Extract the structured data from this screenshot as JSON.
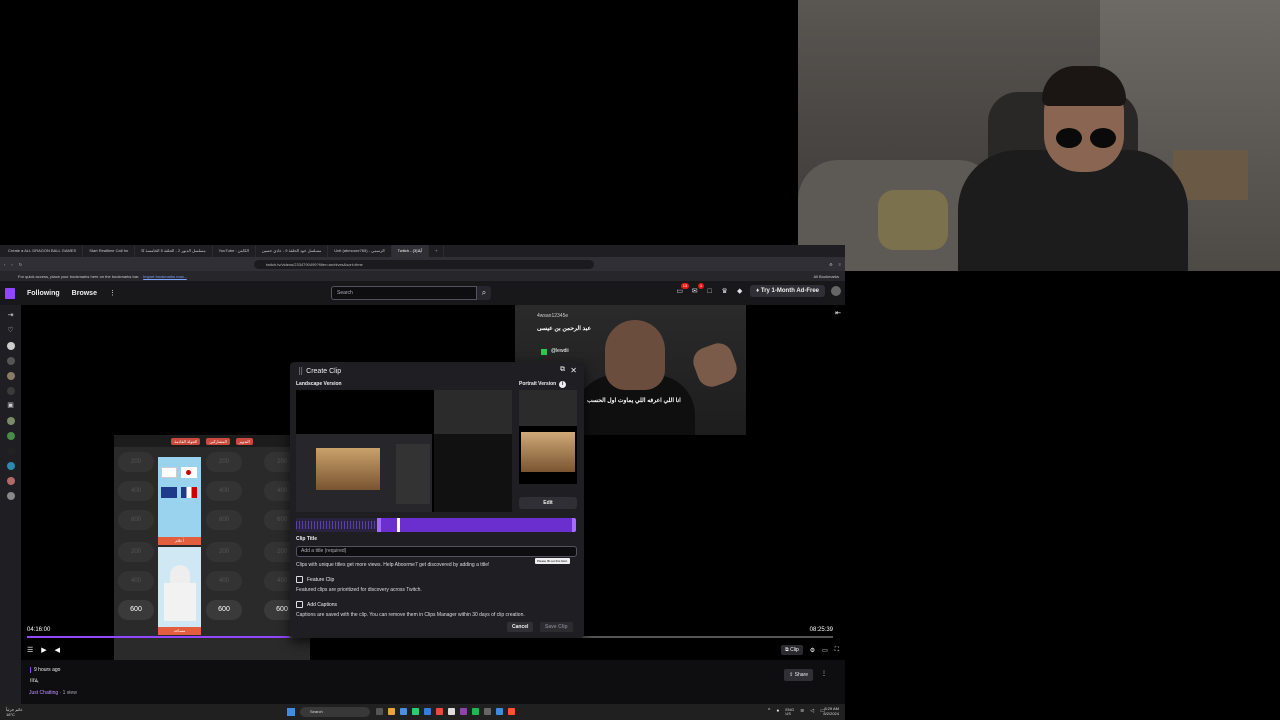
{
  "browser": {
    "tabs": [
      {
        "label": "Create a ALL DRAGON BALL GAMES",
        "active": false
      },
      {
        "label": "Start Realtime Call for",
        "active": false
      },
      {
        "label": "مسلسل الدبور 2 - الحلقة 5 الخامسة كا",
        "active": false
      },
      {
        "label": "YouTube : الكابتن",
        "active": false
      },
      {
        "label": "مسلسل خود الحلقة 9 - عادي حسين",
        "active": false
      },
      {
        "label": "Unit (abmoore765) - الرسمي",
        "active": false
      },
      {
        "label": "Twitch - آيلا(3)",
        "active": true
      }
    ],
    "url": "twitch.tv/videos/2334790499?filter=archives&sort=time",
    "bookmark_hint": "For quick access, place your bookmarks here on the bookmarks bar.",
    "bookmark_link": "Import bookmarks now...",
    "all_bookmarks": "All Bookmarks"
  },
  "nav": {
    "following": "Following",
    "browse": "Browse",
    "more": "⋮",
    "search_placeholder": "Search",
    "notif_count": "13",
    "inbox_count": "1",
    "ad_free": "Try 1-Month Ad-Free"
  },
  "player": {
    "time_current": "04:16:00",
    "time_total": "08:25:39",
    "clip_label": "Clip",
    "progress_fraction": 0.325,
    "gameboard": {
      "header": [
        "الجولة القادمة",
        "المشاركين",
        "التدوير"
      ],
      "columns": [
        {
          "values": [
            "200",
            "400",
            "600",
            "200",
            "400",
            "600"
          ]
        },
        {
          "values": [
            "200",
            "400",
            "600",
            "200",
            "400",
            "600"
          ]
        },
        {
          "values": [
            "200",
            "400",
            "600",
            "200",
            "400",
            "600"
          ]
        }
      ],
      "card_labels": [
        "أعلام",
        "مساجد"
      ]
    },
    "cam_overlay": {
      "user1": "4wsan12345e",
      "name": "عبد الرحمن بن عيسى",
      "sub": "@lewdii",
      "caption": "انا اللي اعرفه اللي يماوت اول الحسب"
    }
  },
  "clip_modal": {
    "title": "Create Clip",
    "landscape_label": "Landscape Version",
    "portrait_label": "Portrait Version",
    "info_icon": "i",
    "edit_label": "Edit",
    "clip_title_label": "Clip Title",
    "title_placeholder": "Add a title (required)",
    "tooltip": "Please fill out this field.",
    "help_text": "Clips with unique titles get more views. Help Aboorme7 get discovered by adding a title!",
    "feature_label": "Feature Clip",
    "feature_sub": "Featured clips are prioritized for discovery across Twitch.",
    "captions_label": "Add Captions",
    "captions_sub": "Captions are saved with the clip. You can remove them in Clips Manager within 30 days of clip creation.",
    "cancel_label": "Cancel",
    "save_label": "Save Clip"
  },
  "video_info": {
    "date": "9 hours ago",
    "title": "يلاااا",
    "category": "Just Chatting",
    "views": " · 1 view",
    "share": "Share"
  },
  "taskbar": {
    "weather": "غائم جزئياً",
    "temp": "18°C",
    "search": "Search",
    "lang": "ENG",
    "region": "US",
    "time": "8:29 AM",
    "date": "8/2/2024"
  },
  "colors": {
    "accent": "#9147ff",
    "bg": "#0e0e10",
    "modal": "#1f1f23"
  }
}
